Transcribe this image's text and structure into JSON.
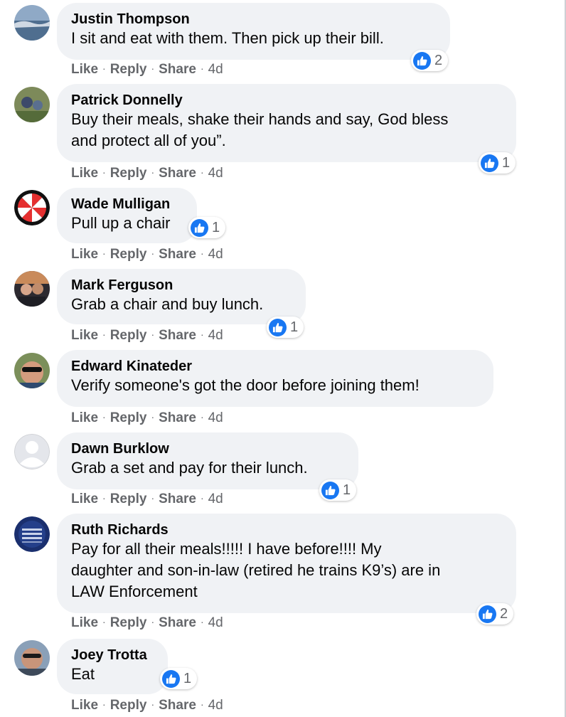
{
  "actions": {
    "like": "Like",
    "reply": "Reply",
    "share": "Share",
    "dot": "·"
  },
  "accent_color": "#1877f2",
  "comments": [
    {
      "author": "Justin Thompson",
      "text": "I sit and eat with them. Then pick up their bill.",
      "reactions": "2",
      "time": "4d"
    },
    {
      "author": "Patrick Donnelly",
      "text": "Buy their meals, shake their hands and say, God bless\nand protect all of you”.",
      "reactions": "1",
      "time": "4d"
    },
    {
      "author": "Wade Mulligan",
      "text": "Pull up a chair",
      "reactions": "1",
      "time": "4d"
    },
    {
      "author": "Mark Ferguson",
      "text": "Grab a chair and buy lunch.",
      "reactions": "1",
      "time": "4d"
    },
    {
      "author": "Edward Kinateder",
      "text": "Verify someone's got the door before joining them!",
      "reactions": "",
      "time": "4d"
    },
    {
      "author": "Dawn Burklow",
      "text": "Grab a set and pay for their lunch.",
      "reactions": "1",
      "time": "4d"
    },
    {
      "author": "Ruth Richards",
      "text": "Pay for all their meals!!!!! I have before!!!! My\ndaughter and son-in-law (retired he trains K9’s) are in\nLAW Enforcement",
      "reactions": "2",
      "time": "4d"
    },
    {
      "author": "Joey Trotta",
      "text": "Eat",
      "reactions": "1",
      "time": "4d"
    }
  ]
}
